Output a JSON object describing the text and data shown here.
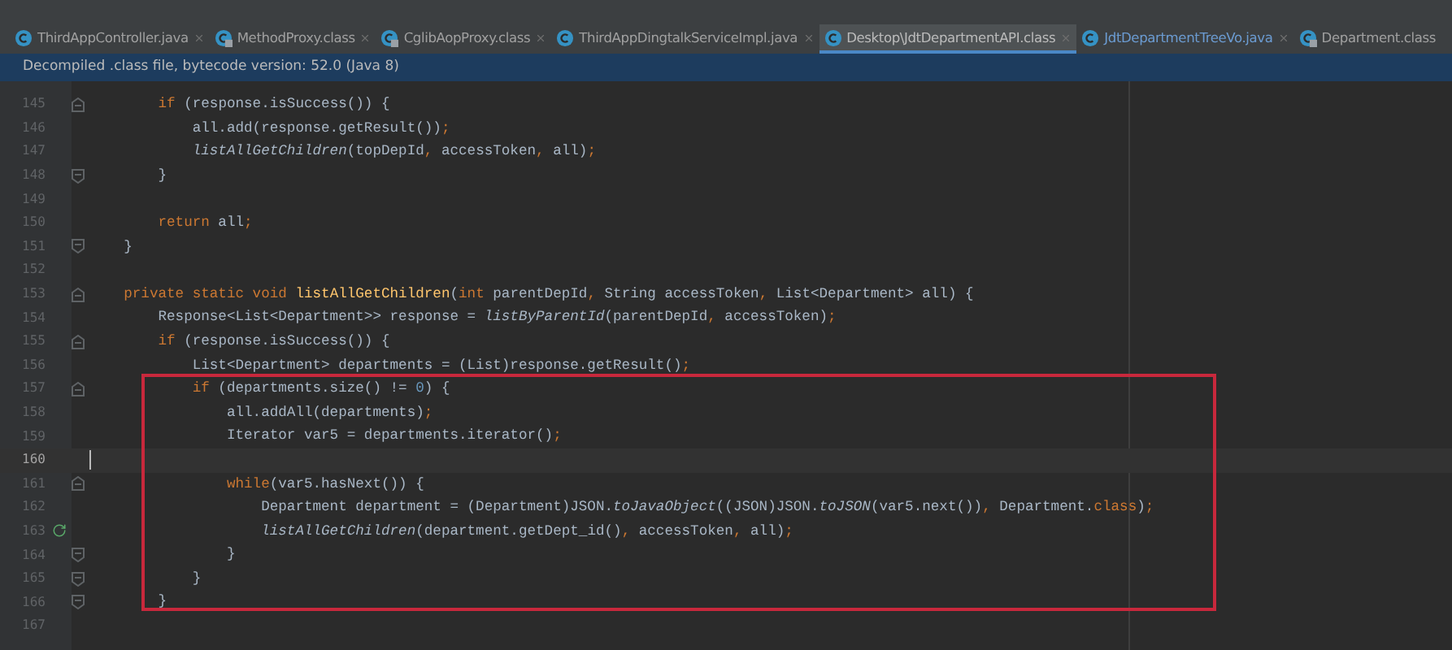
{
  "tabs": [
    {
      "label": "ThirdAppController.java",
      "selected": false,
      "locked": false,
      "closable": true
    },
    {
      "label": "MethodProxy.class",
      "selected": false,
      "locked": true,
      "closable": true
    },
    {
      "label": "CglibAopProxy.class",
      "selected": false,
      "locked": true,
      "closable": true
    },
    {
      "label": "ThirdAppDingtalkServiceImpl.java",
      "selected": false,
      "locked": false,
      "closable": true
    },
    {
      "label": "Desktop\\JdtDepartmentAPI.class",
      "selected": true,
      "locked": false,
      "closable": true
    },
    {
      "label": "JdtDepartmentTreeVo.java",
      "selected": false,
      "locked": false,
      "closable": true
    },
    {
      "label": "Department.class",
      "selected": false,
      "locked": true,
      "closable": false
    }
  ],
  "banner": {
    "text": "Decompiled .class file, bytecode version: 52.0 (Java 8)"
  },
  "editor": {
    "lines": [
      {
        "number": "145",
        "fold_start": true,
        "fold_end": false,
        "recursive": false,
        "current": false,
        "tokens": [
          {
            "text": "        if",
            "kind": "keyword"
          },
          {
            "text": " (response.isSuccess()) {",
            "kind": "plain"
          }
        ]
      },
      {
        "number": "146",
        "fold_start": false,
        "fold_end": false,
        "recursive": false,
        "current": false,
        "tokens": [
          {
            "text": "            all.add(response.getResult())",
            "kind": "plain"
          },
          {
            "text": ";",
            "kind": "punct"
          }
        ]
      },
      {
        "number": "147",
        "fold_start": false,
        "fold_end": false,
        "recursive": false,
        "current": false,
        "tokens": [
          {
            "text": "            listAllGetChildren",
            "kind": "static_call"
          },
          {
            "text": "(topDepId",
            "kind": "plain"
          },
          {
            "text": ",",
            "kind": "punct"
          },
          {
            "text": " accessToken",
            "kind": "plain"
          },
          {
            "text": ",",
            "kind": "punct"
          },
          {
            "text": " all)",
            "kind": "plain"
          },
          {
            "text": ";",
            "kind": "punct"
          }
        ]
      },
      {
        "number": "148",
        "fold_start": false,
        "fold_end": true,
        "recursive": false,
        "current": false,
        "tokens": [
          {
            "text": "        }",
            "kind": "plain"
          }
        ]
      },
      {
        "number": "149",
        "fold_start": false,
        "fold_end": false,
        "recursive": false,
        "current": false
      },
      {
        "number": "150",
        "fold_start": false,
        "fold_end": false,
        "recursive": false,
        "current": false,
        "tokens": [
          {
            "text": "        return",
            "kind": "keyword"
          },
          {
            "text": " all",
            "kind": "plain"
          },
          {
            "text": ";",
            "kind": "punct"
          }
        ]
      },
      {
        "number": "151",
        "fold_start": false,
        "fold_end": true,
        "recursive": false,
        "current": false,
        "tokens": [
          {
            "text": "    }",
            "kind": "plain"
          }
        ]
      },
      {
        "number": "152",
        "fold_start": false,
        "fold_end": false,
        "recursive": false,
        "current": false
      },
      {
        "number": "153",
        "fold_start": true,
        "fold_end": false,
        "recursive": false,
        "current": false,
        "tokens": [
          {
            "text": "    private static void ",
            "kind": "keyword"
          },
          {
            "text": "listAllGetChildren",
            "kind": "declaration"
          },
          {
            "text": "(",
            "kind": "plain"
          },
          {
            "text": "int",
            "kind": "keyword"
          },
          {
            "text": " parentDepId",
            "kind": "plain"
          },
          {
            "text": ",",
            "kind": "punct"
          },
          {
            "text": " String accessToken",
            "kind": "plain"
          },
          {
            "text": ",",
            "kind": "punct"
          },
          {
            "text": " List<Department> all) {",
            "kind": "plain"
          }
        ]
      },
      {
        "number": "154",
        "fold_start": false,
        "fold_end": false,
        "recursive": false,
        "current": false,
        "tokens": [
          {
            "text": "        Response<List<Department>> response = ",
            "kind": "plain"
          },
          {
            "text": "listByParentId",
            "kind": "static_call"
          },
          {
            "text": "(parentDepId",
            "kind": "plain"
          },
          {
            "text": ",",
            "kind": "punct"
          },
          {
            "text": " accessToken)",
            "kind": "plain"
          },
          {
            "text": ";",
            "kind": "punct"
          }
        ]
      },
      {
        "number": "155",
        "fold_start": true,
        "fold_end": false,
        "recursive": false,
        "current": false,
        "tokens": [
          {
            "text": "        if",
            "kind": "keyword"
          },
          {
            "text": " (response.isSuccess()) {",
            "kind": "plain"
          }
        ]
      },
      {
        "number": "156",
        "fold_start": false,
        "fold_end": false,
        "recursive": false,
        "current": false,
        "tokens": [
          {
            "text": "            List<Department> departments = (List)response.getResult()",
            "kind": "plain"
          },
          {
            "text": ";",
            "kind": "punct"
          }
        ]
      },
      {
        "number": "157",
        "fold_start": true,
        "fold_end": false,
        "recursive": false,
        "current": false,
        "tokens": [
          {
            "text": "            if",
            "kind": "keyword"
          },
          {
            "text": " (departments.size() != ",
            "kind": "plain"
          },
          {
            "text": "0",
            "kind": "number"
          },
          {
            "text": ") {",
            "kind": "plain"
          }
        ]
      },
      {
        "number": "158",
        "fold_start": false,
        "fold_end": false,
        "recursive": false,
        "current": false,
        "tokens": [
          {
            "text": "                all.addAll(departments)",
            "kind": "plain"
          },
          {
            "text": ";",
            "kind": "punct"
          }
        ]
      },
      {
        "number": "159",
        "fold_start": false,
        "fold_end": false,
        "recursive": false,
        "current": false,
        "tokens": [
          {
            "text": "                Iterator var5 = departments.iterator()",
            "kind": "plain"
          },
          {
            "text": ";",
            "kind": "punct"
          }
        ]
      },
      {
        "number": "160",
        "fold_start": false,
        "fold_end": false,
        "recursive": false,
        "current": true
      },
      {
        "number": "161",
        "fold_start": true,
        "fold_end": false,
        "recursive": false,
        "current": false,
        "tokens": [
          {
            "text": "                while",
            "kind": "keyword"
          },
          {
            "text": "(var5.hasNext()) {",
            "kind": "plain"
          }
        ]
      },
      {
        "number": "162",
        "fold_start": false,
        "fold_end": false,
        "recursive": false,
        "current": false,
        "tokens": [
          {
            "text": "                    Department department = (Department)JSON.",
            "kind": "plain"
          },
          {
            "text": "toJavaObject",
            "kind": "static_call"
          },
          {
            "text": "((JSON)JSON.",
            "kind": "plain"
          },
          {
            "text": "toJSON",
            "kind": "static_call"
          },
          {
            "text": "(var5.next())",
            "kind": "plain"
          },
          {
            "text": ",",
            "kind": "punct"
          },
          {
            "text": " Department.",
            "kind": "plain"
          },
          {
            "text": "class",
            "kind": "keyword"
          },
          {
            "text": ")",
            "kind": "plain"
          },
          {
            "text": ";",
            "kind": "punct"
          }
        ]
      },
      {
        "number": "163",
        "fold_start": false,
        "fold_end": false,
        "recursive": true,
        "current": false,
        "tokens": [
          {
            "text": "                    listAllGetChildren",
            "kind": "static_call"
          },
          {
            "text": "(department.getDept_id()",
            "kind": "plain"
          },
          {
            "text": ",",
            "kind": "punct"
          },
          {
            "text": " accessToken",
            "kind": "plain"
          },
          {
            "text": ",",
            "kind": "punct"
          },
          {
            "text": " all)",
            "kind": "plain"
          },
          {
            "text": ";",
            "kind": "punct"
          }
        ]
      },
      {
        "number": "164",
        "fold_start": false,
        "fold_end": true,
        "recursive": false,
        "current": false,
        "tokens": [
          {
            "text": "                }",
            "kind": "plain"
          }
        ]
      },
      {
        "number": "165",
        "fold_start": false,
        "fold_end": true,
        "recursive": false,
        "current": false,
        "tokens": [
          {
            "text": "            }",
            "kind": "plain"
          }
        ]
      },
      {
        "number": "166",
        "fold_start": false,
        "fold_end": true,
        "recursive": false,
        "current": false,
        "tokens": [
          {
            "text": "        }",
            "kind": "plain"
          }
        ]
      },
      {
        "number": "167",
        "fold_start": false,
        "fold_end": false,
        "recursive": false,
        "current": false
      }
    ]
  }
}
